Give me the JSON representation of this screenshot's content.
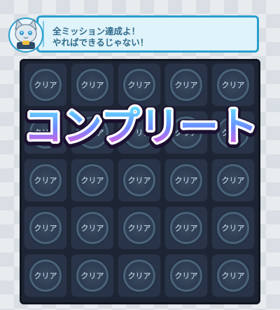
{
  "banner": {
    "line1": "全ミッション達成よ！",
    "line2": "やればできるじゃない！"
  },
  "board": {
    "cells": [
      "クリア",
      "クリア",
      "クリア",
      "クリア",
      "クリア",
      "クリア",
      "クリア",
      "クリア",
      "クリア",
      "クリア",
      "クリア",
      "クリア",
      "クリア",
      "クリア",
      "クリア",
      "クリア",
      "クリア",
      "クリア",
      "クリア",
      "クリア",
      "クリア",
      "クリア",
      "クリア",
      "クリア",
      "クリア"
    ]
  },
  "complete_banner": {
    "text": "コンプリート"
  },
  "colors": {
    "board_bg": "#1d2433",
    "cell_bg": "#2a3448",
    "banner_border": "#2a9fcd",
    "complete_gradient_top": "#5ee9ff",
    "complete_gradient_bottom": "#ff4fd8"
  },
  "icons": {
    "avatar": "cat-character-avatar"
  }
}
